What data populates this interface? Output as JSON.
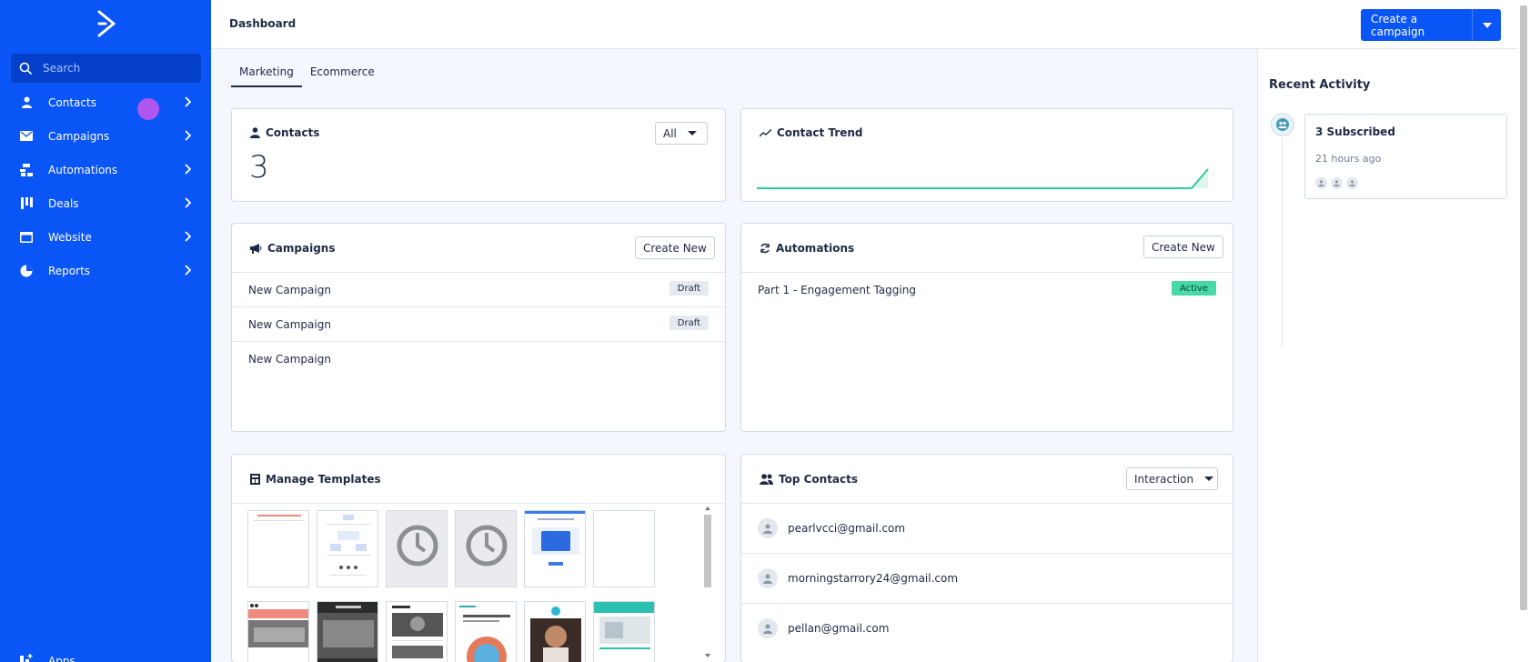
{
  "sidebar": {
    "logo_icon": "activecampaign-chevron-icon",
    "search_placeholder": "Search",
    "items": [
      {
        "label": "Contacts",
        "icon": "person-icon"
      },
      {
        "label": "Campaigns",
        "icon": "envelope-icon"
      },
      {
        "label": "Automations",
        "icon": "flow-icon"
      },
      {
        "label": "Deals",
        "icon": "pipeline-icon"
      },
      {
        "label": "Website",
        "icon": "browser-icon"
      },
      {
        "label": "Reports",
        "icon": "pie-chart-icon"
      }
    ],
    "apps_label": "Apps"
  },
  "header": {
    "title": "Dashboard",
    "create_button": "Create a campaign"
  },
  "tabs": [
    {
      "label": "Marketing",
      "active": true
    },
    {
      "label": "Ecommerce",
      "active": false
    }
  ],
  "contacts_card": {
    "title": "Contacts",
    "filter": "All",
    "count": "3"
  },
  "trend_card": {
    "title": "Contact Trend",
    "line_color": "#2fcb9a"
  },
  "campaigns_card": {
    "title": "Campaigns",
    "create_label": "Create New",
    "rows": [
      {
        "name": "New Campaign",
        "status": "Draft"
      },
      {
        "name": "New Campaign",
        "status": "Draft"
      },
      {
        "name": "New Campaign",
        "status": ""
      }
    ]
  },
  "automations_card": {
    "title": "Automations",
    "create_label": "Create New",
    "rows": [
      {
        "name": "Part 1 - Engagement Tagging",
        "status": "Active"
      }
    ]
  },
  "templates_card": {
    "title": "Manage Templates"
  },
  "top_contacts_card": {
    "title": "Top Contacts",
    "filter": "Interaction",
    "contacts": [
      {
        "email": "pearlvcci@gmail.com"
      },
      {
        "email": "morningstarrory24@gmail.com"
      },
      {
        "email": "pellan@gmail.com"
      }
    ]
  },
  "recent_activity": {
    "title": "Recent Activity",
    "items": [
      {
        "title": "3 Subscribed",
        "time": "21 hours ago"
      }
    ]
  },
  "colors": {
    "sidebar": "#0a55f5",
    "accent": "#0a55f5",
    "active_badge": "#48d9a8"
  }
}
